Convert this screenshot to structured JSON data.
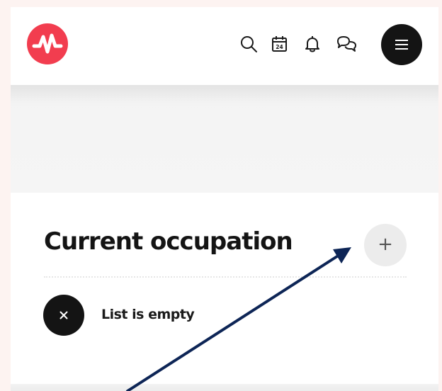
{
  "header": {
    "logo": "pulse-logo",
    "icons": [
      "search-icon",
      "calendar-icon",
      "bell-icon",
      "chat-icon"
    ],
    "calendar_day": "24",
    "menu": "hamburger-icon"
  },
  "section": {
    "title": "Current occupation",
    "add_label": "+",
    "empty_text": "List is empty",
    "empty_icon": "close-icon"
  },
  "colors": {
    "brand": "#f23d4f",
    "dark": "#141414",
    "arrow": "#0d2556"
  }
}
